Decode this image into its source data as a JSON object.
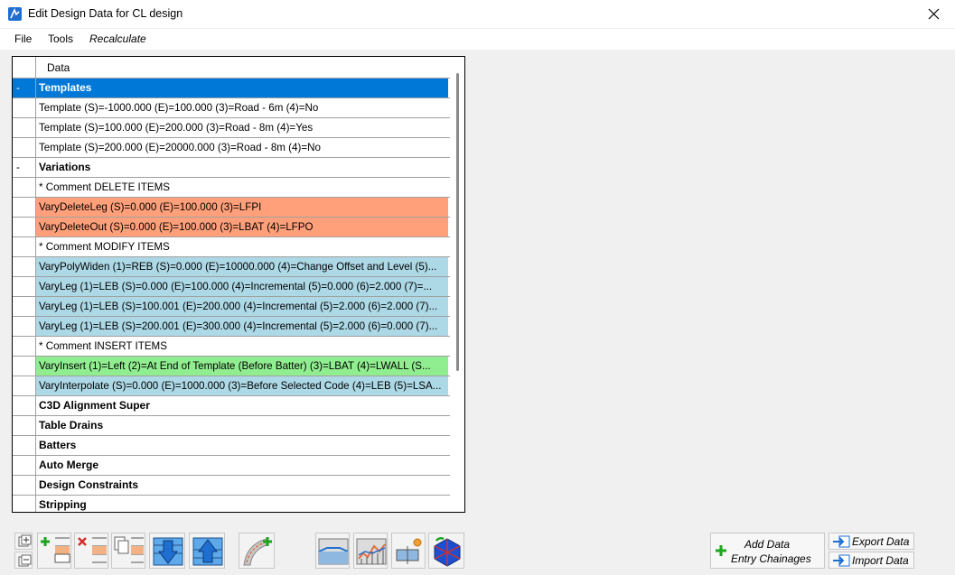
{
  "window": {
    "title": "Edit Design Data for CL design",
    "close_label": "×"
  },
  "menu": {
    "file": "File",
    "tools": "Tools",
    "recalculate": "Recalculate"
  },
  "grid": {
    "column_header": "Data",
    "rows": [
      {
        "marker": "-",
        "text": "Templates",
        "style": "selected bold"
      },
      {
        "marker": "",
        "text": "Template (S)=-1000.000  (E)=100.000  (3)=Road - 6m  (4)=No",
        "style": ""
      },
      {
        "marker": "",
        "text": "Template (S)=100.000  (E)=200.000  (3)=Road - 8m  (4)=Yes",
        "style": ""
      },
      {
        "marker": "",
        "text": "Template (S)=200.000  (E)=20000.000  (3)=Road - 8m  (4)=No",
        "style": ""
      },
      {
        "marker": "-",
        "text": "Variations",
        "style": "bold"
      },
      {
        "marker": "",
        "text": "*  Comment DELETE ITEMS",
        "style": ""
      },
      {
        "marker": "",
        "text": "VaryDeleteLeg (S)=0.000  (E)=100.000  (3)=LFPI",
        "style": "orange"
      },
      {
        "marker": "",
        "text": "VaryDeleteOut (S)=0.000  (E)=100.000  (3)=LBAT  (4)=LFPO",
        "style": "orange"
      },
      {
        "marker": "",
        "text": "*  Comment MODIFY ITEMS",
        "style": ""
      },
      {
        "marker": "",
        "text": "VaryPolyWiden (1)=REB  (S)=0.000  (E)=10000.000  (4)=Change Offset and Level  (5)...",
        "style": "blue"
      },
      {
        "marker": "",
        "text": "VaryLeg (1)=LEB  (S)=0.000  (E)=100.000  (4)=Incremental  (5)=0.000  (6)=2.000  (7)=...",
        "style": "blue"
      },
      {
        "marker": "",
        "text": "VaryLeg (1)=LEB  (S)=100.001  (E)=200.000  (4)=Incremental  (5)=2.000  (6)=2.000  (7)...",
        "style": "blue"
      },
      {
        "marker": "",
        "text": "VaryLeg (1)=LEB  (S)=200.001  (E)=300.000  (4)=Incremental  (5)=2.000  (6)=0.000  (7)...",
        "style": "blue"
      },
      {
        "marker": "",
        "text": "*  Comment INSERT ITEMS",
        "style": ""
      },
      {
        "marker": "",
        "text": "VaryInsert (1)=Left  (2)=At End of Template (Before Batter)  (3)=LBAT  (4)=LWALL  (S...",
        "style": "green"
      },
      {
        "marker": "",
        "text": "VaryInterpolate (S)=0.000  (E)=1000.000  (3)=Before Selected Code  (4)=LEB  (5)=LSA...",
        "style": "blue"
      },
      {
        "marker": "",
        "text": "C3D Alignment Super",
        "style": "bold"
      },
      {
        "marker": "",
        "text": "Table Drains",
        "style": "bold"
      },
      {
        "marker": "",
        "text": "Batters",
        "style": "bold"
      },
      {
        "marker": "",
        "text": "Auto Merge",
        "style": "bold"
      },
      {
        "marker": "",
        "text": "Design Constraints",
        "style": "bold"
      },
      {
        "marker": "",
        "text": "Stripping",
        "style": "bold"
      }
    ]
  },
  "buttons": {
    "add_data_line1": "Add Data",
    "add_data_line2": "Entry Chainages",
    "export_data": "Export Data",
    "import_data": "Import Data"
  },
  "toolbar_icons": [
    "expand-collapse-icon",
    "insert-row-icon",
    "delete-row-icon",
    "copy-row-icon",
    "move-down-icon",
    "move-up-icon",
    "add-variation-icon",
    "section-view-icon",
    "profile-view-icon",
    "settings-section-icon",
    "3d-view-icon"
  ],
  "colors": {
    "selected": "#0078d7",
    "delete": "#ffa07a",
    "modify": "#add8e6",
    "insert": "#90ee90",
    "icon_blue": "#1f6fd1",
    "plus_green": "#1fa31f"
  }
}
